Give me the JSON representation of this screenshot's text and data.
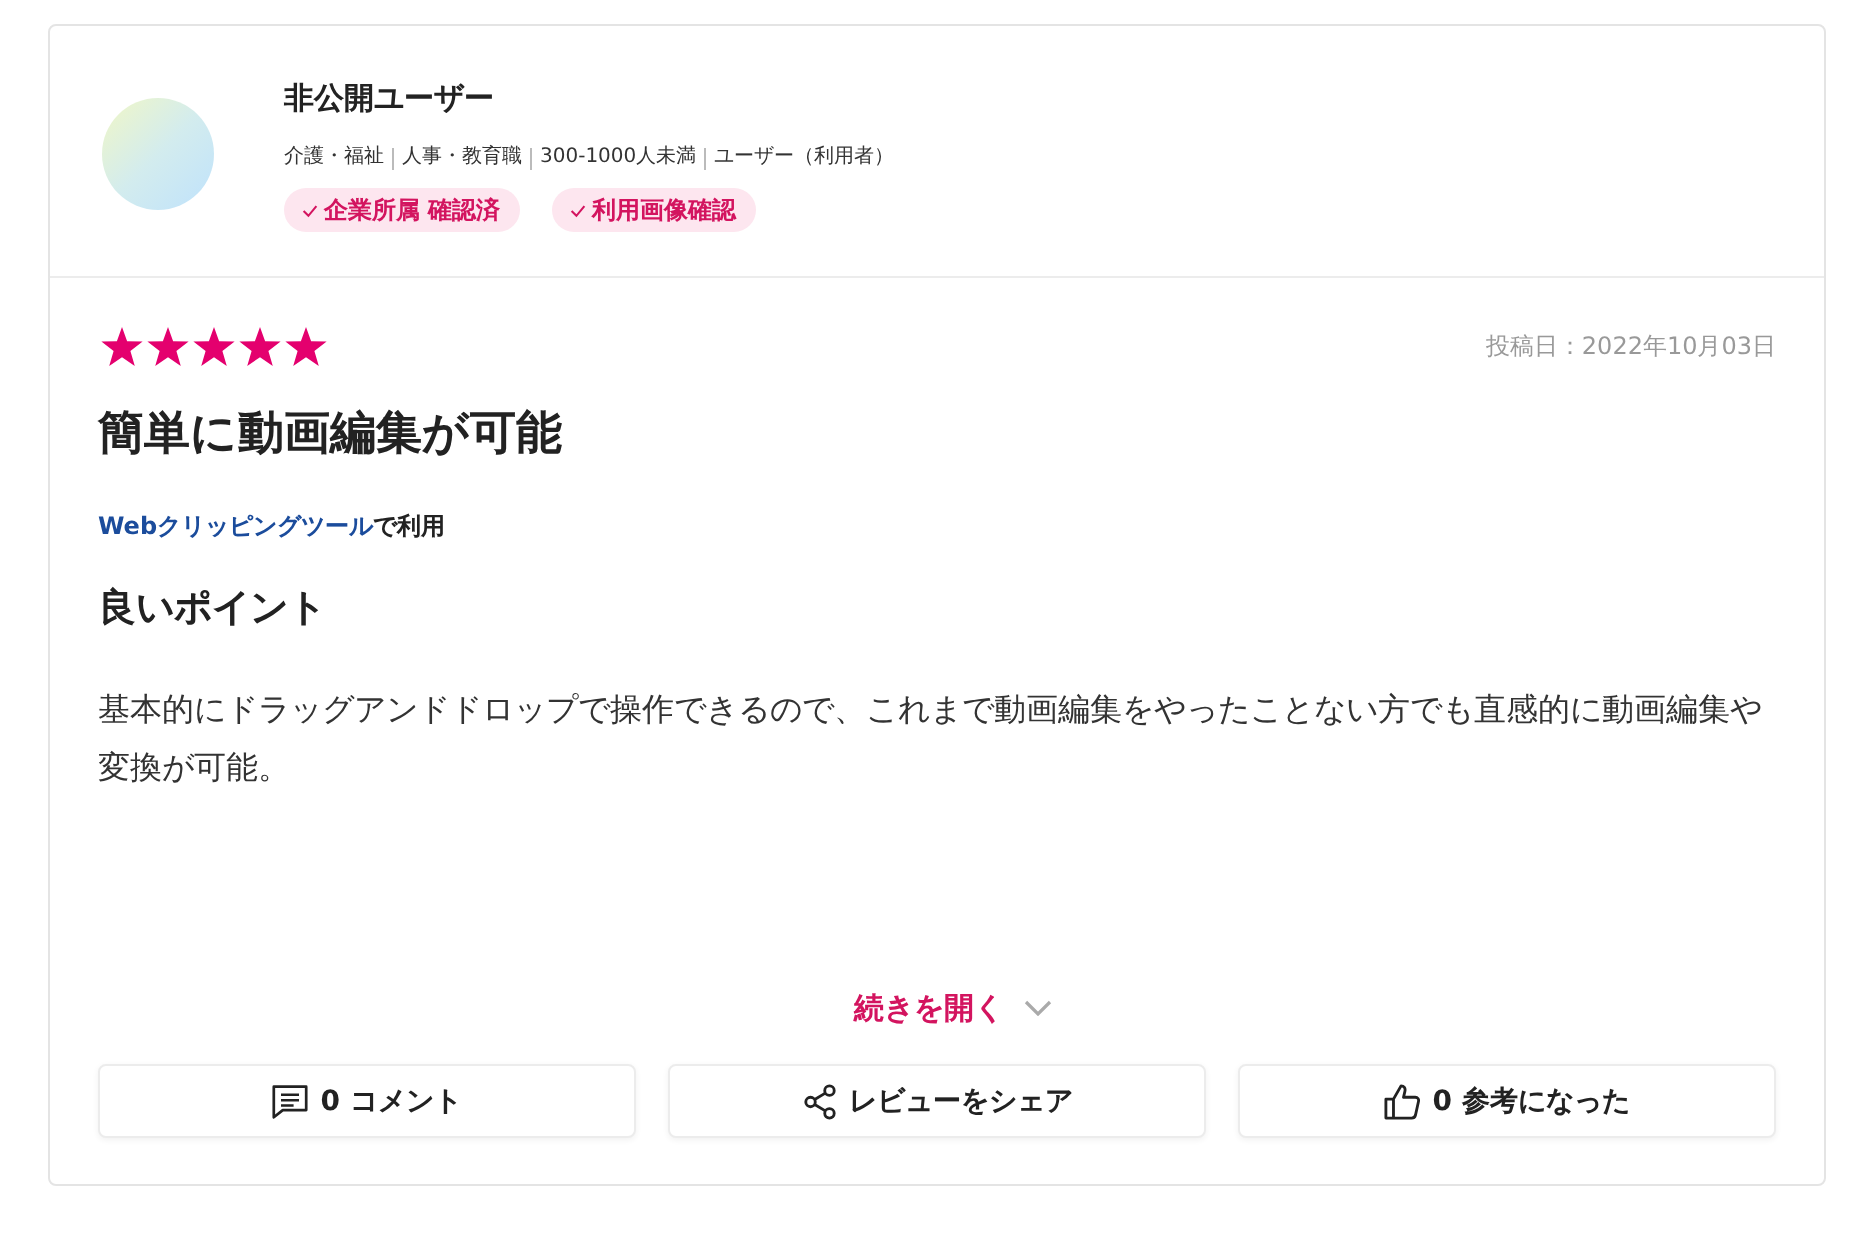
{
  "reviewer": {
    "name": "非公開ユーザー",
    "details": [
      "介護・福祉",
      "人事・教育職",
      "300-1000人未満",
      "ユーザー（利用者）"
    ],
    "badges": [
      "企業所属 確認済",
      "利用画像確認"
    ]
  },
  "review": {
    "stars": 5,
    "posted": "投稿日：2022年10月03日",
    "title": "簡単に動画編集が可能",
    "product": "Webクリッピングツール",
    "usage_suffix": "で利用",
    "section_heading": "良いポイント",
    "body": "基本的にドラッグアンドドロップで操作できるので、これまで動画編集をやったことない方でも直感的に動画編集や変換が可能。",
    "expand": "続きを開く"
  },
  "actions": [
    {
      "kind": "comment",
      "label": "0 コメント"
    },
    {
      "kind": "share",
      "label": "レビューをシェア"
    },
    {
      "kind": "helpful",
      "label": "0 参考になった"
    }
  ]
}
